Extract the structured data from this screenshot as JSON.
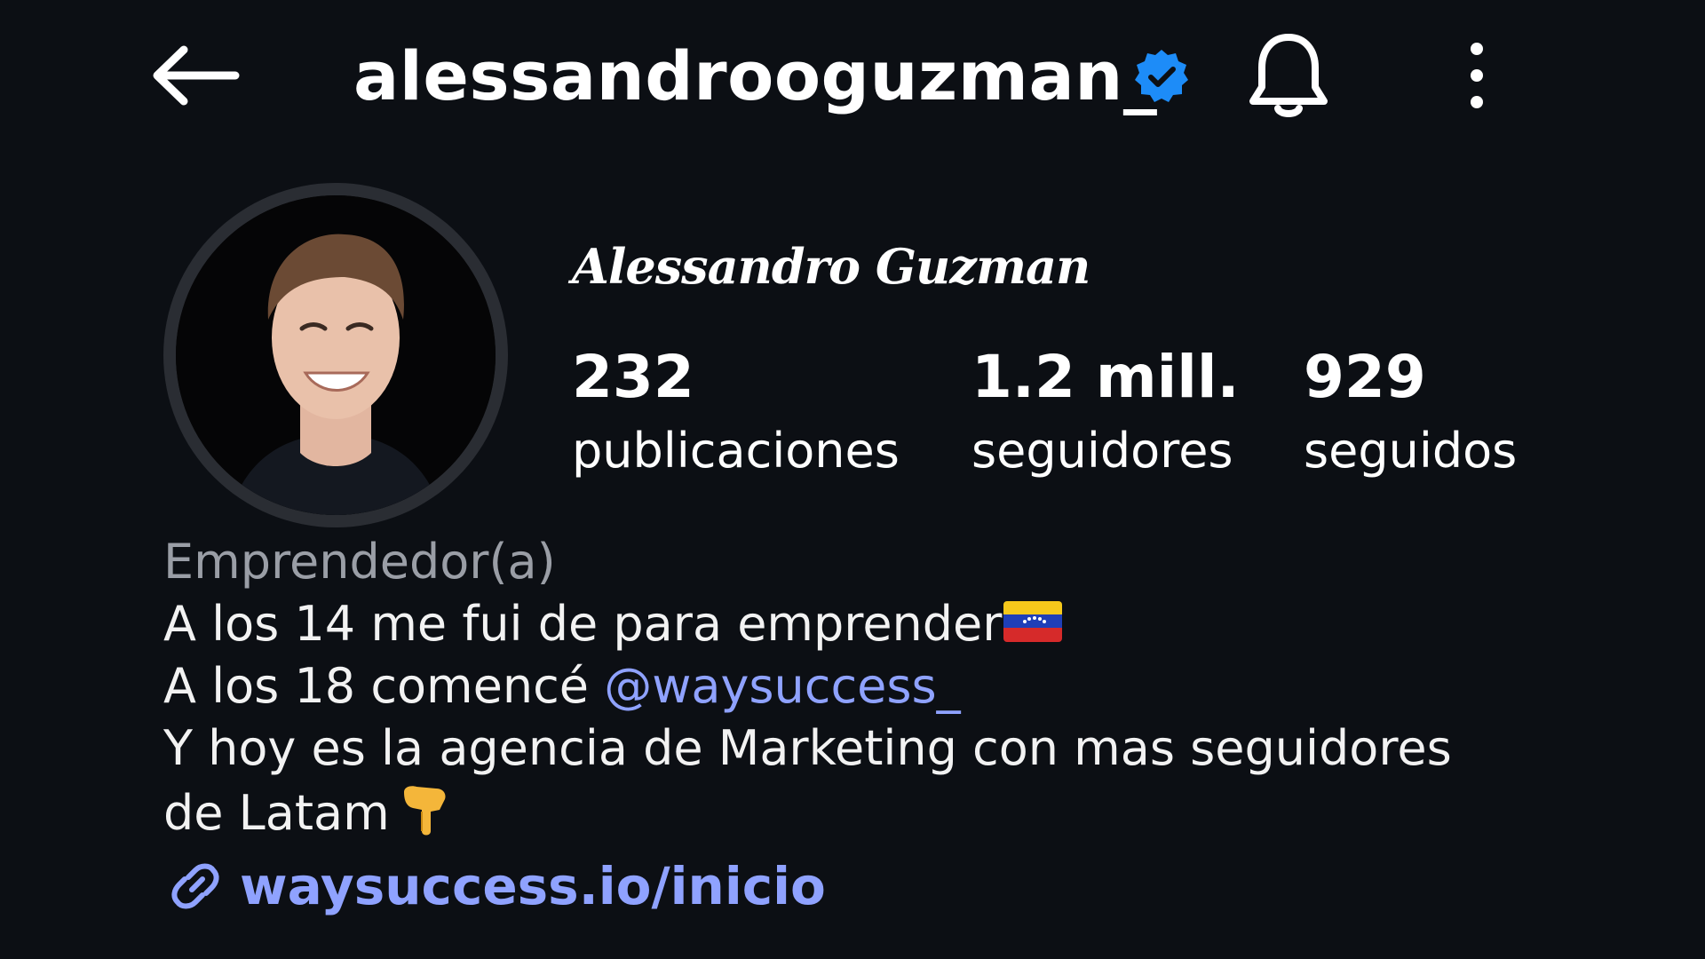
{
  "header": {
    "username": "alessandrooguzman_",
    "back_icon": "arrow-left-icon",
    "verified_icon": "verified-badge-icon",
    "bell_icon": "bell-icon",
    "more_icon": "more-vertical-icon"
  },
  "profile": {
    "display_name": "Alessandro Guzman",
    "stats": [
      {
        "value": "232",
        "label": "publicaciones"
      },
      {
        "value": "1.2 mill.",
        "label": "seguidores"
      },
      {
        "value": "929",
        "label": "seguidos"
      }
    ]
  },
  "bio": {
    "category": "Emprendedor(a)",
    "line1": "A los 14 me fui de para emprender",
    "line2_prefix": "A los 18 comencé ",
    "mention": "@waysuccess_",
    "line3": "Y hoy es la agencia de Marketing con mas seguidores",
    "line4": "de Latam",
    "link": "waysuccess.io/inicio"
  },
  "colors": {
    "background": "#0c0f14",
    "link": "#8fa2ff",
    "verified": "#1d8cf8",
    "muted": "#9a9ea6"
  }
}
